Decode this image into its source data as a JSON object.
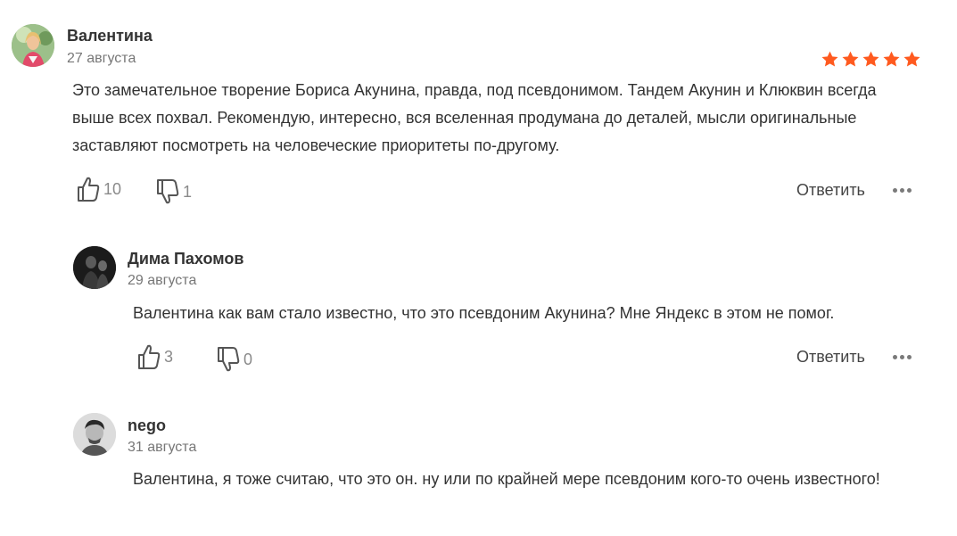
{
  "review": {
    "author": "Валентина",
    "date": "27 августа",
    "rating": 5,
    "rating_color": "#ff5a1f",
    "text": "Это замечательное творение Бориса Акунина, правда, под псевдонимом. Тандем Акунин и Клюквин всегда выше всех похвал. Рекомендую, интересно, вся вселенная продумана до деталей, мысли оригинальные заставляют посмотреть на человеческие приоритеты по-другому.",
    "likes": "10",
    "dislikes": "1",
    "reply_label": "Ответить"
  },
  "comments": [
    {
      "author": "Дима Пахомов",
      "date": "29 августа",
      "text": "Валентина как вам стало известно, что это псевдоним Акунина? Мне Яндекс в этом не помог.",
      "likes": "3",
      "dislikes": "0",
      "reply_label": "Ответить"
    },
    {
      "author": "nego",
      "date": "31 августа",
      "text": "Валентина, я тоже считаю, что это он. ну или по крайней мере псевдоним кого-то очень известного!"
    }
  ]
}
